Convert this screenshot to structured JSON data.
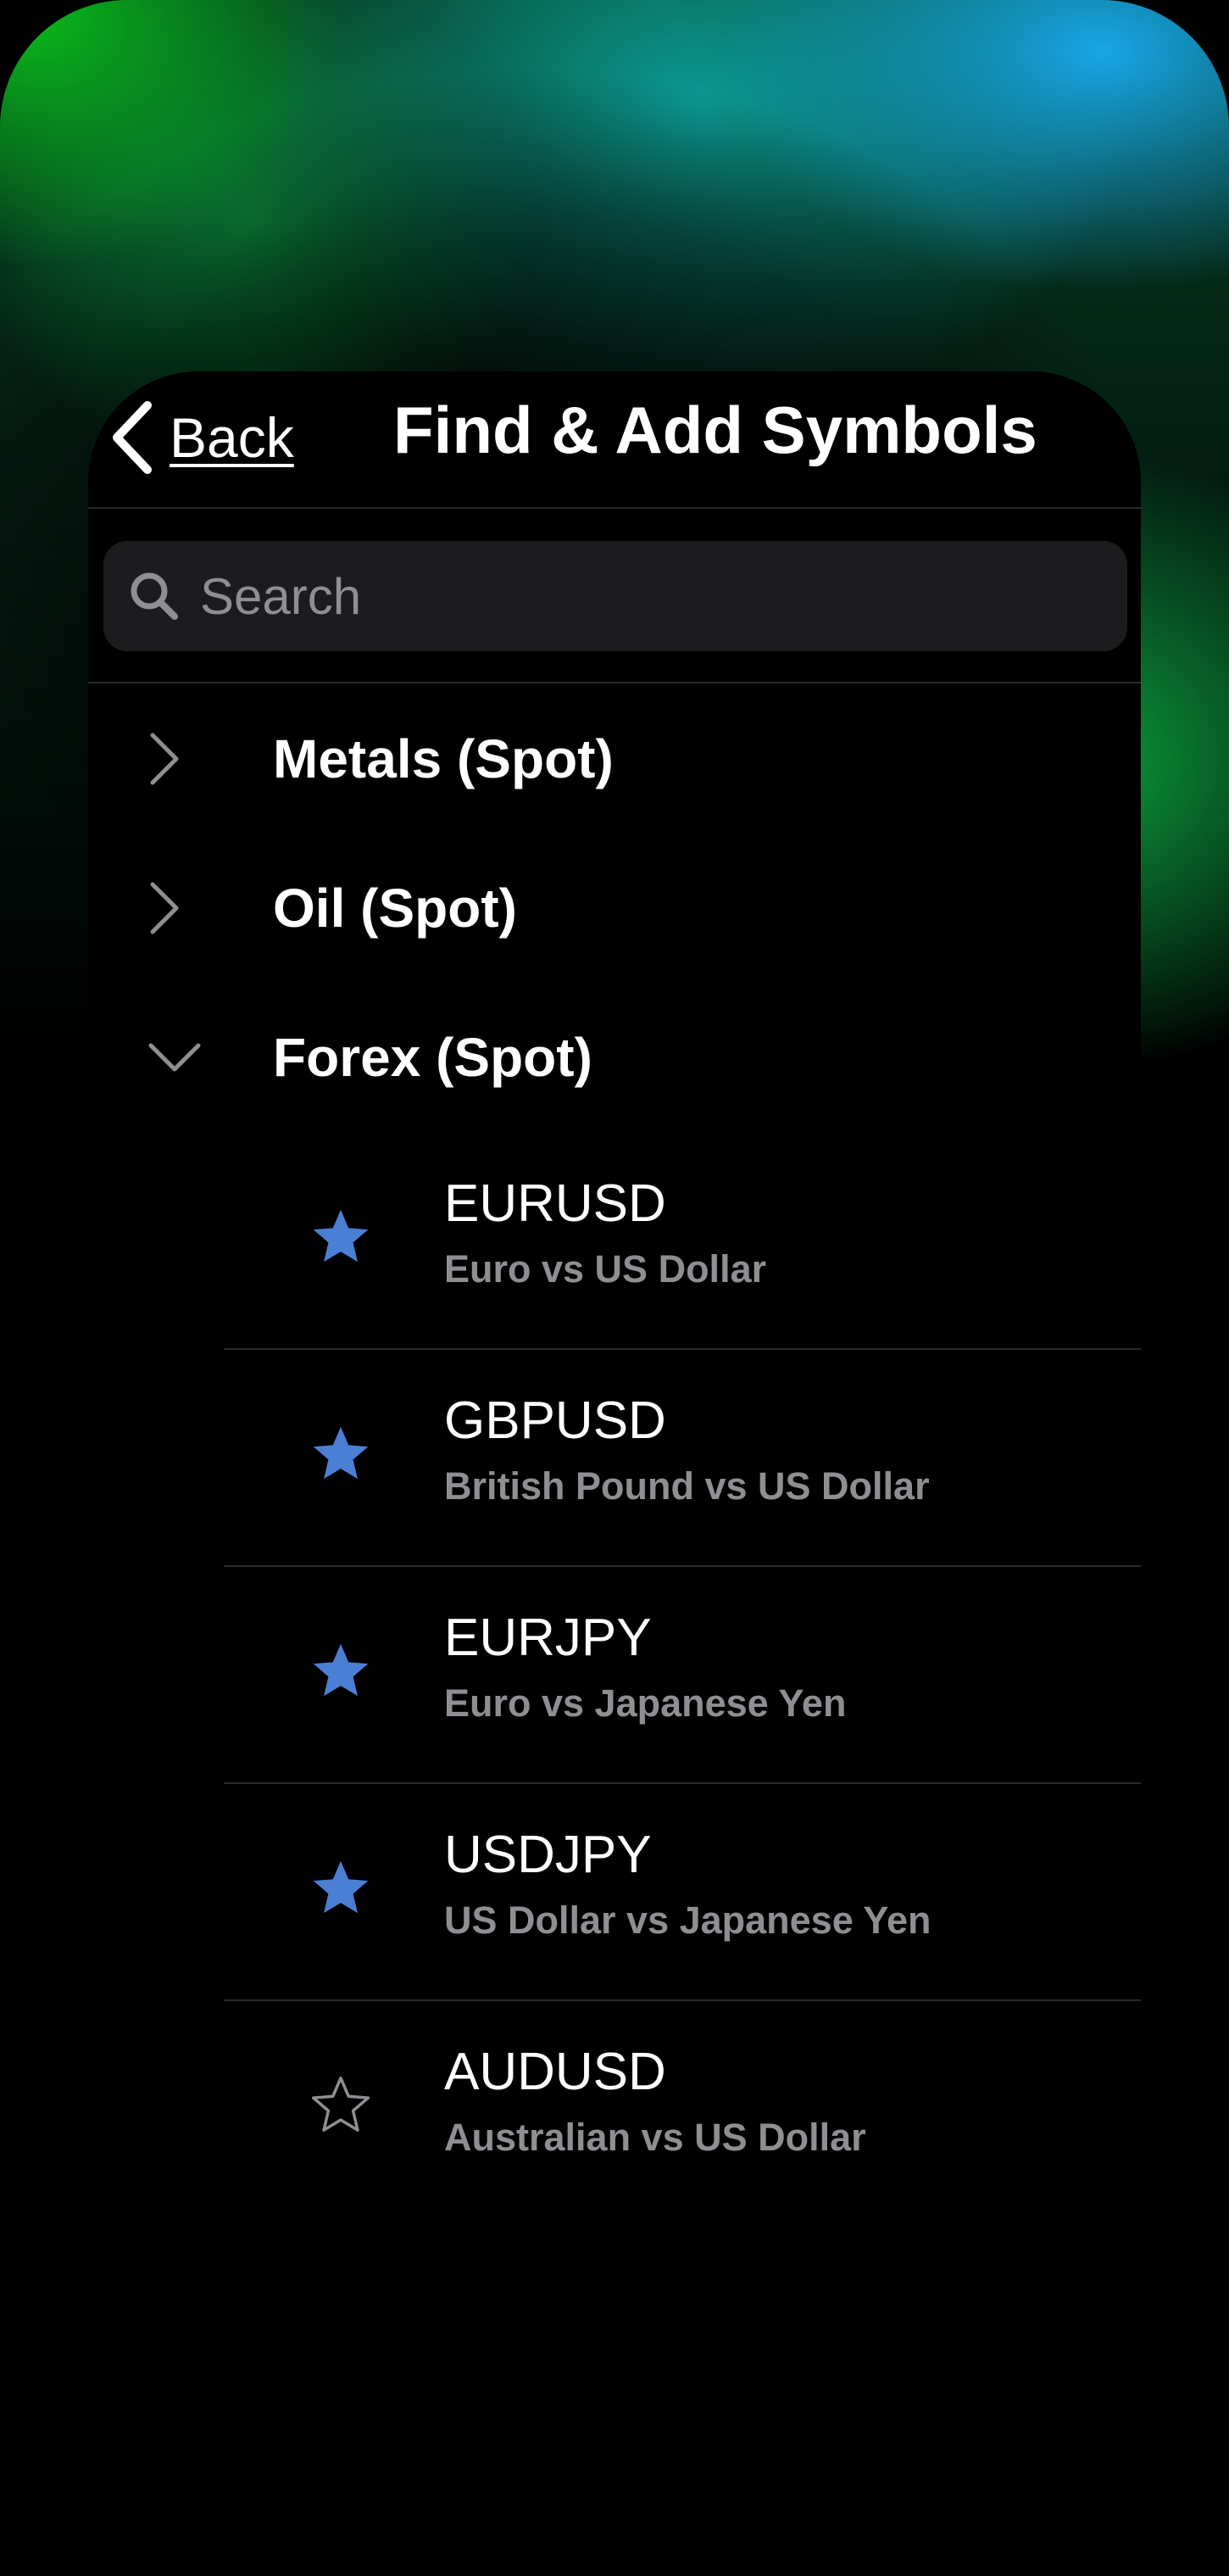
{
  "nav": {
    "back_label": "Back",
    "title": "Find & Add Symbols"
  },
  "search": {
    "placeholder": "Search"
  },
  "groups": [
    {
      "label": "Metals (Spot)",
      "expanded": false
    },
    {
      "label": "Oil (Spot)",
      "expanded": false
    },
    {
      "label": "Forex (Spot)",
      "expanded": true
    }
  ],
  "symbols": [
    {
      "code": "EURUSD",
      "description": "Euro vs US Dollar",
      "favorite": true
    },
    {
      "code": "GBPUSD",
      "description": "British Pound vs US Dollar",
      "favorite": true
    },
    {
      "code": "EURJPY",
      "description": "Euro vs Japanese Yen",
      "favorite": true
    },
    {
      "code": "USDJPY",
      "description": "US Dollar vs Japanese Yen",
      "favorite": true
    },
    {
      "code": "AUDUSD",
      "description": "Australian vs US Dollar",
      "favorite": false
    }
  ],
  "colors": {
    "accent": "#4a7fd4",
    "background": "#000000",
    "search_bg": "#1c1c1e",
    "secondary_text": "#8e8e93"
  }
}
